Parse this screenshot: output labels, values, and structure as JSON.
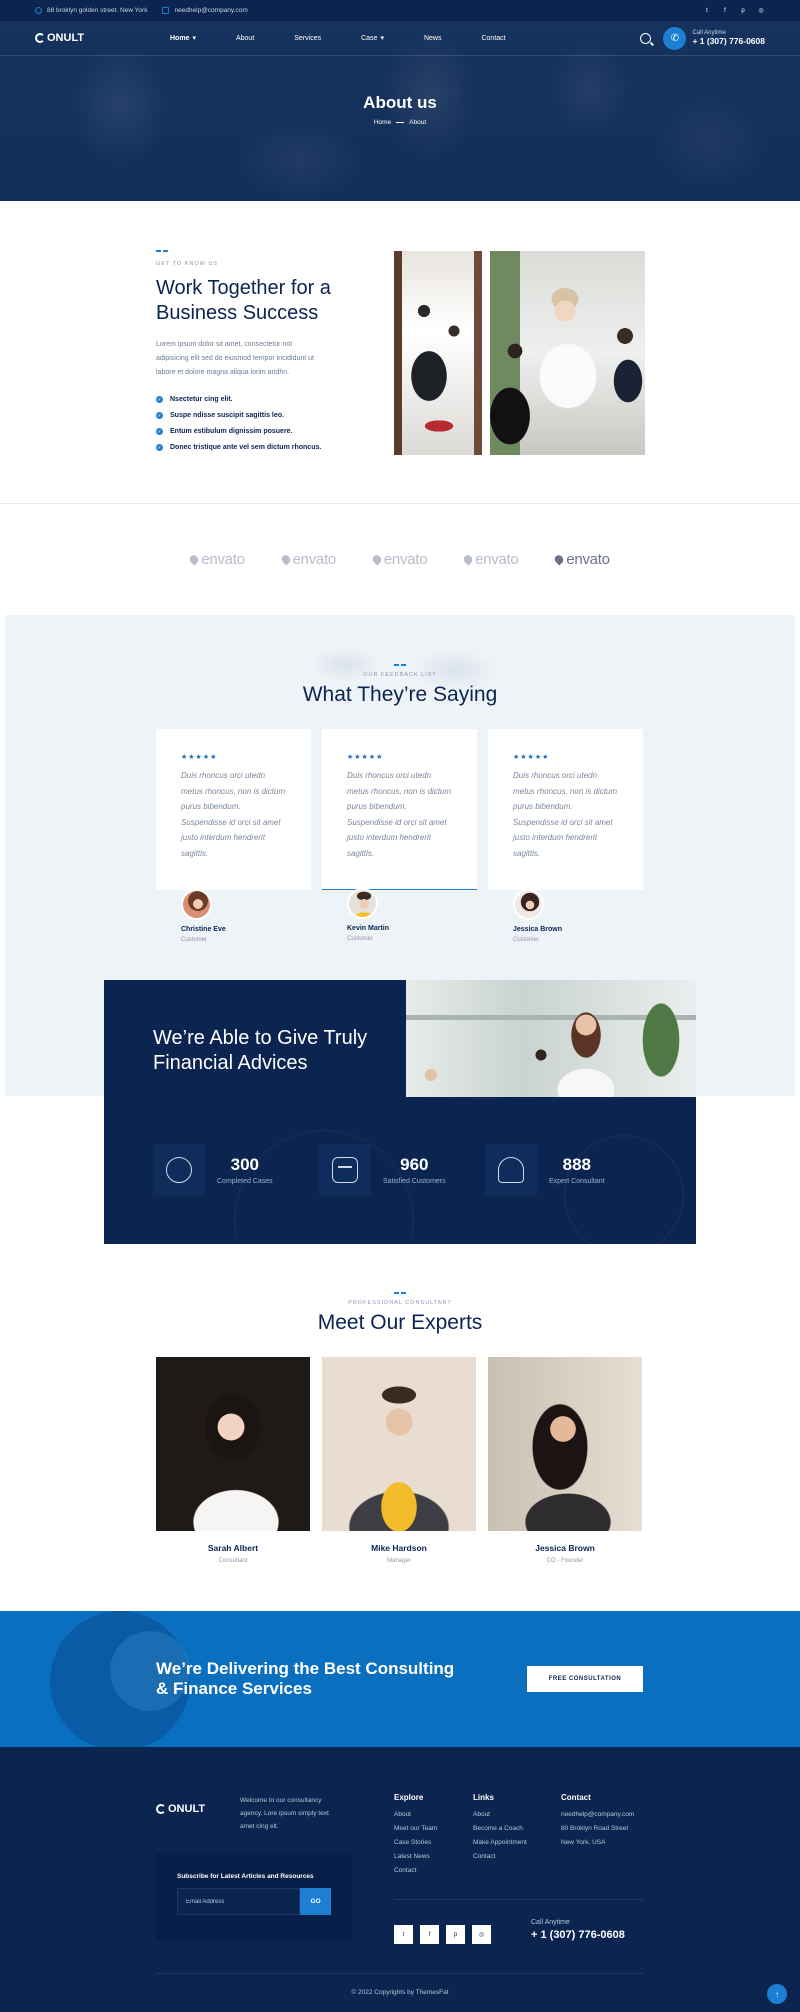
{
  "topbar": {
    "address": "88 broklyn golden street. New York",
    "email": "needhelp@company.com",
    "socials": [
      "twitter-icon",
      "facebook-icon",
      "pinterest-icon",
      "instagram-icon"
    ]
  },
  "nav": {
    "logo": "ONULT",
    "items": [
      {
        "label": "Home",
        "dropdown": true
      },
      {
        "label": "About",
        "dropdown": false
      },
      {
        "label": "Services",
        "dropdown": false
      },
      {
        "label": "Case",
        "dropdown": true
      },
      {
        "label": "News",
        "dropdown": false
      },
      {
        "label": "Contact",
        "dropdown": false
      }
    ],
    "call_label": "Call Anytime",
    "call_number": "+ 1 (307) 776-0608"
  },
  "hero": {
    "title": "About us",
    "breadcrumb": [
      "Home",
      "About"
    ]
  },
  "about": {
    "eyebrow": "GET TO KNOW US",
    "title": "Work Together for a Business Success",
    "text": "Lorem ipsum dolor sit amet, consectetur not adipisicing elit sed do eiusmod tempor incididunt ut labore et dolore magna aliqua lorim andhn.",
    "checks": [
      "Nsectetur cing elit.",
      "Suspe ndisse suscipit sagittis leo.",
      "Entum estibulum dignissim posuere.",
      "Donec tristique ante vel sem dictum rhoncus."
    ]
  },
  "brands": [
    "envato",
    "envato",
    "envato",
    "envato",
    "envato"
  ],
  "testimonials": {
    "eyebrow": "OUR FEEDBACK LIST",
    "title": "What They’re Saying",
    "stars": "★★★★★",
    "items": [
      {
        "quote": "Duis rhoncus orci utedn metus rhoncus, non is dictum purus bibendum. Suspendisse id orci sit amet justo interdum hendrerit sagittis.",
        "name": "Christine Eve",
        "role": "Customer"
      },
      {
        "quote": "Duis rhoncus orci utedn metus rhoncus, non is dictum purus bibendum. Suspendisse id orci sit amet justo interdum hendrerit sagittis.",
        "name": "Kevin Martin",
        "role": "Customer"
      },
      {
        "quote": "Duis rhoncus orci utedn metus rhoncus, non is dictum purus bibendum. Suspendisse id orci sit amet justo interdum hendrerit sagittis.",
        "name": "Jessica Brown",
        "role": "Customer"
      }
    ]
  },
  "financial": {
    "title": "We’re Able to Give Truly Financial Advices",
    "stats": [
      {
        "number": "300",
        "label": "Completed Cases"
      },
      {
        "number": "960",
        "label": "Satisfied Customers"
      },
      {
        "number": "888",
        "label": "Expert Consultant"
      }
    ]
  },
  "experts": {
    "eyebrow": "PROFESSIONAL CONSULTANT",
    "title": "Meet Our Experts",
    "members": [
      {
        "name": "Sarah Albert",
        "role": "Consultant"
      },
      {
        "name": "Mike Hardson",
        "role": "Manager"
      },
      {
        "name": "Jessica Brown",
        "role": "CO - Founder"
      }
    ]
  },
  "cta": {
    "title": "We’re Delivering the Best Consulting & Finance Services",
    "button": "FREE CONSULTATION"
  },
  "footer": {
    "logo": "ONULT",
    "about": "Welcome to our consultancy agency. Lore ipsum simply text amet cing elt.",
    "subscribe_title": "Subscribe for Latest Articles and Resources",
    "email_placeholder": "Email Address",
    "go": "GO",
    "explore": {
      "title": "Explore",
      "links": [
        "About",
        "Meet our Team",
        "Case Stories",
        "Latest News",
        "Contact"
      ]
    },
    "links": {
      "title": "Links",
      "links": [
        "About",
        "Become a Coach",
        "Make Appointment",
        "Contact"
      ]
    },
    "contact": {
      "title": "Contact",
      "lines": [
        "needhelp@company.com",
        "80 Broklyn Road Street",
        "New York. USA"
      ]
    },
    "call_label": "Call Anytime",
    "call_number": "+ 1 (307) 776-0608",
    "copyright": "© 2022 Copyrights by ThemesFat"
  },
  "colors": {
    "navy": "#0b2450",
    "accent": "#1d7fd1",
    "cta_blue": "#0a6fbf",
    "light_bg": "#eef3f7"
  }
}
